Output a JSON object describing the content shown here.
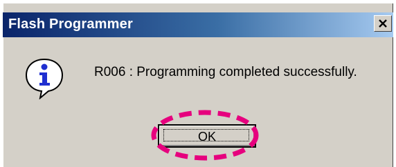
{
  "dialog": {
    "title": "Flash Programmer",
    "close_label": "X",
    "message": "R006 : Programming completed successfully.",
    "icon": "info-icon",
    "ok_label": "OK"
  },
  "colors": {
    "title_start": "#0a246a",
    "title_end": "#a6caf0",
    "dialog_bg": "#d4d0c8",
    "highlight": "#e6007e"
  }
}
